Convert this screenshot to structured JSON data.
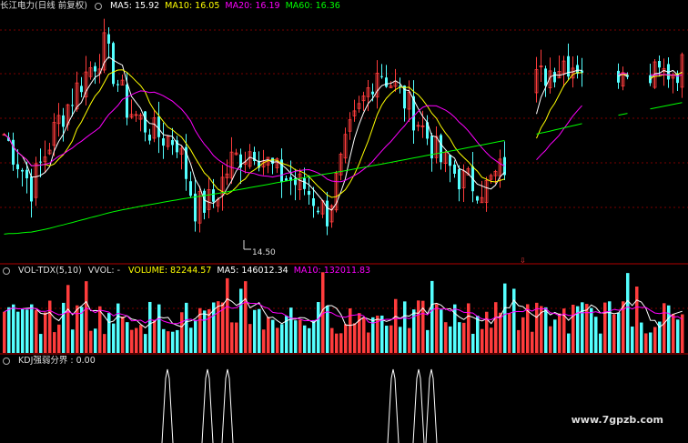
{
  "price_header": {
    "title": "长江电力(日线 前复权)",
    "ma_labels": [
      {
        "text": "MA5: 15.92",
        "color": "#ffffff"
      },
      {
        "text": "MA10: 16.05",
        "color": "#ffff00"
      },
      {
        "text": "MA20: 16.19",
        "color": "#ff00ff"
      },
      {
        "text": "MA60: 16.36",
        "color": "#00ff00"
      }
    ]
  },
  "volume_header": {
    "title": "VOL-TDX(5,10)",
    "vvol": "VVOL: -",
    "labels": [
      {
        "text": "VOLUME: 82244.57",
        "color": "#ffff00"
      },
      {
        "text": "MA5: 146012.34",
        "color": "#ffffff"
      },
      {
        "text": "MA10: 132011.83",
        "color": "#ff00ff"
      }
    ]
  },
  "kdj_header": {
    "title": "KDJ强弱分界 : 0.00"
  },
  "low_marker": "14.50",
  "watermark": "www.7gpzb.com",
  "colors": {
    "up": "#ff3c3c",
    "down": "#54ffff",
    "grid": "#7a0000",
    "separator": "#b00000"
  },
  "chart_data": {
    "type": "candlestick",
    "panels": [
      "price",
      "volume",
      "kdj"
    ],
    "low_label": 14.5,
    "series": [
      {
        "name": "MA5",
        "last": 15.92
      },
      {
        "name": "MA10",
        "last": 16.05
      },
      {
        "name": "MA20",
        "last": 16.19
      },
      {
        "name": "MA60",
        "last": 16.36
      },
      {
        "name": "VOLUME",
        "last": 82244.57
      },
      {
        "name": "MA5",
        "last": 146012.34
      },
      {
        "name": "MA10",
        "last": 132011.83
      },
      {
        "name": "KDJ强弱分界",
        "last": 0.0
      }
    ]
  }
}
